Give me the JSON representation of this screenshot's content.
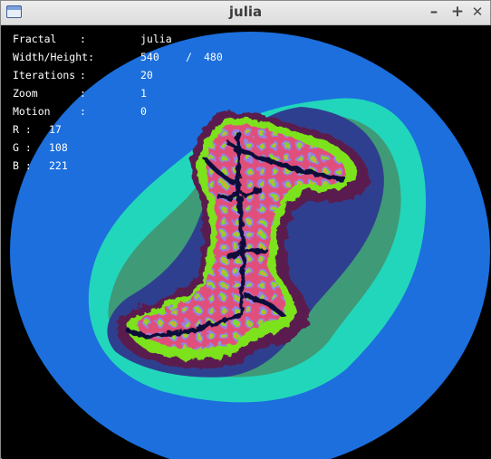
{
  "window": {
    "title": "julia",
    "controls": {
      "minimize": "–",
      "maximize": "+",
      "close": "✕"
    },
    "icon": "window-icon"
  },
  "info": {
    "fractal": {
      "label": "Fractal",
      "sep": ":",
      "value": "julia"
    },
    "size": {
      "label": "Width/Height:",
      "width": "540",
      "slash": "/",
      "height": "480"
    },
    "iterations": {
      "label": "Iterations",
      "sep": ":",
      "value": "20"
    },
    "zoom": {
      "label": "Zoom",
      "sep": ":",
      "value": "1"
    },
    "motion": {
      "label": "Motion",
      "sep": ":",
      "value": "0"
    },
    "r": {
      "label": "R :",
      "value": "17"
    },
    "g": {
      "label": "G :",
      "value": "108"
    },
    "b": {
      "label": "B :",
      "value": "221"
    }
  },
  "colors": {
    "outer": "#1c6fdd",
    "ring_teal": "#22d6bb",
    "ring_green": "#3f9a78",
    "ring_navy": "#2f3f8f",
    "ring_purple": "#5a1f4f",
    "ring_lime": "#7ce21a",
    "core_pink": "#e0507a",
    "core_lavender": "#9a7fe6",
    "core_dark": "#10103a"
  }
}
